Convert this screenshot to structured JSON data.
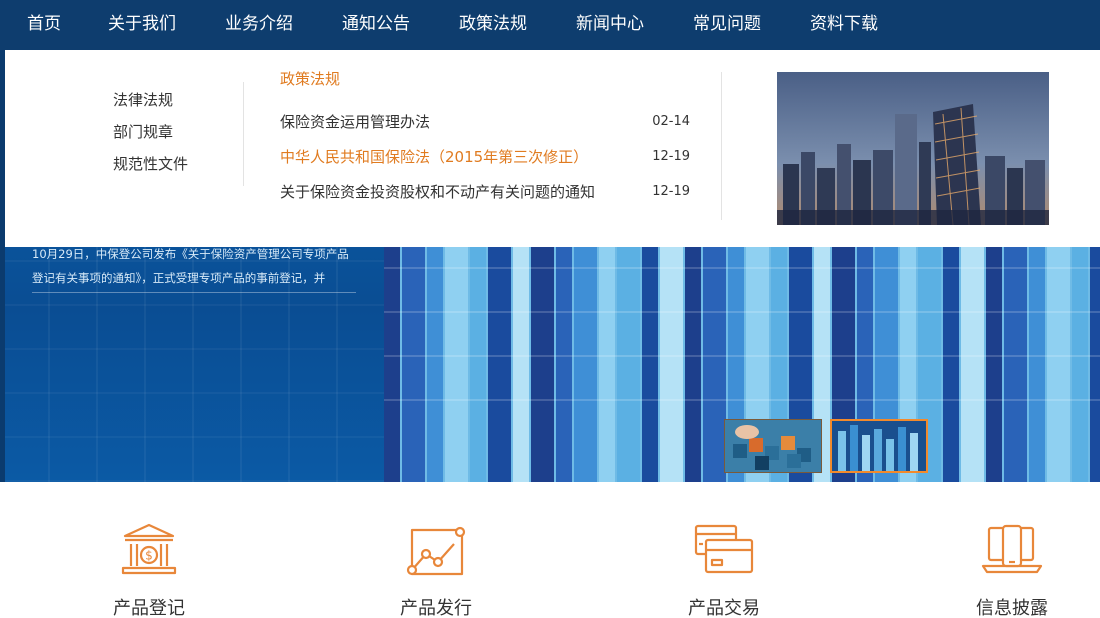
{
  "nav": {
    "items": [
      {
        "label": "首页"
      },
      {
        "label": "关于我们"
      },
      {
        "label": "业务介绍"
      },
      {
        "label": "通知公告"
      },
      {
        "label": "政策法规"
      },
      {
        "label": "新闻中心"
      },
      {
        "label": "常见问题"
      },
      {
        "label": "资料下载"
      }
    ]
  },
  "dropdown": {
    "side_links": [
      {
        "label": "法律法规"
      },
      {
        "label": "部门规章"
      },
      {
        "label": "规范性文件"
      }
    ],
    "section_title": "政策法规",
    "items": [
      {
        "title": "保险资金运用管理办法",
        "date": "02-14"
      },
      {
        "title": "中华人民共和国保险法（2015年第三次修正）",
        "date": "12-19"
      },
      {
        "title": "关于保险资金投资股权和不动产有关问题的通知",
        "date": "12-19"
      }
    ]
  },
  "hero": {
    "text": "10月29日，中保登公司发布《关于保险资产管理公司专项产品登记有关事项的通知》，正式受理专项产品的事前登记，并"
  },
  "services": [
    {
      "label": "产品登记",
      "icon": "bank-icon"
    },
    {
      "label": "产品发行",
      "icon": "chart-line-icon"
    },
    {
      "label": "产品交易",
      "icon": "credit-card-icon"
    },
    {
      "label": "信息披露",
      "icon": "laptop-phone-icon"
    }
  ],
  "colors": {
    "nav_bg": "#0e3d6e",
    "accent": "#e07b20",
    "icon": "#e8873a"
  }
}
